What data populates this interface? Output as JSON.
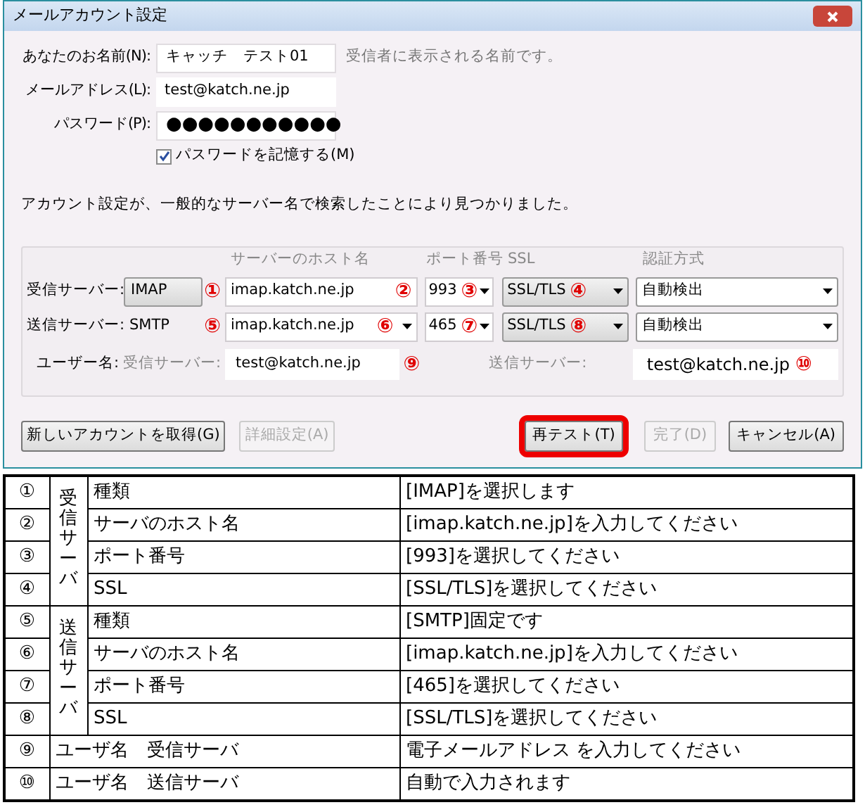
{
  "window": {
    "title": "メールアカウント設定"
  },
  "identity": {
    "name": {
      "label": "あなたのお名前(N):",
      "value": "キャッチ　テスト01",
      "hint": "受信者に表示される名前です。"
    },
    "email": {
      "label": "メールアドレス(L):",
      "value": "test@katch.ne.jp"
    },
    "password": {
      "label": "パスワード(P):",
      "value": "●●●●●●●●●●●"
    },
    "remember": {
      "label": "パスワードを記憶する(M)",
      "checked": true
    }
  },
  "message": "アカウント設定が、一般的なサーバー名で検索したことにより見つかりました。",
  "server_headers": [
    "サーバーのホスト名",
    "ポート番号",
    "SSL",
    "認証方式"
  ],
  "servers": [
    {
      "label": "受信サーバー:",
      "protocol": "IMAP",
      "kind": "select",
      "protocol_marker": "①",
      "host": "imap.katch.ne.jp",
      "host_marker": "②",
      "host_dropdown": false,
      "port": "993",
      "port_marker": "③",
      "ssl": "SSL/TLS",
      "ssl_marker": "④",
      "auth": "自動検出"
    },
    {
      "label": "送信サーバー:",
      "protocol": "SMTP",
      "kind": "fixed",
      "protocol_marker": "⑤",
      "host": "imap.katch.ne.jp",
      "host_marker": "⑥",
      "host_dropdown": true,
      "port": "465",
      "port_marker": "⑦",
      "ssl": "SSL/TLS",
      "ssl_marker": "⑧",
      "auth": "自動検出"
    }
  ],
  "username": {
    "label": "ユーザー名:",
    "incoming_label": "受信サーバー:",
    "incoming_value": "test@katch.ne.jp",
    "incoming_marker": "⑨",
    "outgoing_label": "送信サーバー:",
    "outgoing_value": "test@katch.ne.jp",
    "outgoing_marker": "⑩"
  },
  "buttons_left": [
    {
      "label": "新しいアカウントを取得(G)",
      "disabled": false
    },
    {
      "label": "詳細設定(A)",
      "disabled": true
    }
  ],
  "buttons_right": [
    {
      "label": "再テスト(T)",
      "disabled": false,
      "highlighted": true
    },
    {
      "label": "完了(D)",
      "disabled": true,
      "highlighted": false
    },
    {
      "label": "キャンセル(A)",
      "disabled": false,
      "highlighted": false
    }
  ],
  "table": {
    "groups": [
      {
        "label": "受信サーバ",
        "rows": [
          {
            "num": "①",
            "item": "種類",
            "desc": "[IMAP]を選択します"
          },
          {
            "num": "②",
            "item": "サーバのホスト名",
            "desc": "[imap.katch.ne.jp]を入力してください"
          },
          {
            "num": "③",
            "item": "ポート番号",
            "desc": "[993]を選択してください"
          },
          {
            "num": "④",
            "item": "SSL",
            "desc": "[SSL/TLS]を選択してください"
          }
        ]
      },
      {
        "label": "送信サーバ",
        "rows": [
          {
            "num": "⑤",
            "item": "種類",
            "desc": "[SMTP]固定です"
          },
          {
            "num": "⑥",
            "item": "サーバのホスト名",
            "desc": "[imap.katch.ne.jp]を入力してください"
          },
          {
            "num": "⑦",
            "item": "ポート番号",
            "desc": "[465]を選択してください"
          },
          {
            "num": "⑧",
            "item": "SSL",
            "desc": "[SSL/TLS]を選択してください"
          }
        ]
      }
    ],
    "extra_rows": [
      {
        "num": "⑨",
        "item": "ユーザ名　受信サーバ",
        "desc": "電子メールアドレス を入力してください"
      },
      {
        "num": "⑩",
        "item": "ユーザ名　送信サーバ",
        "desc": "自動で入力されます"
      }
    ]
  }
}
